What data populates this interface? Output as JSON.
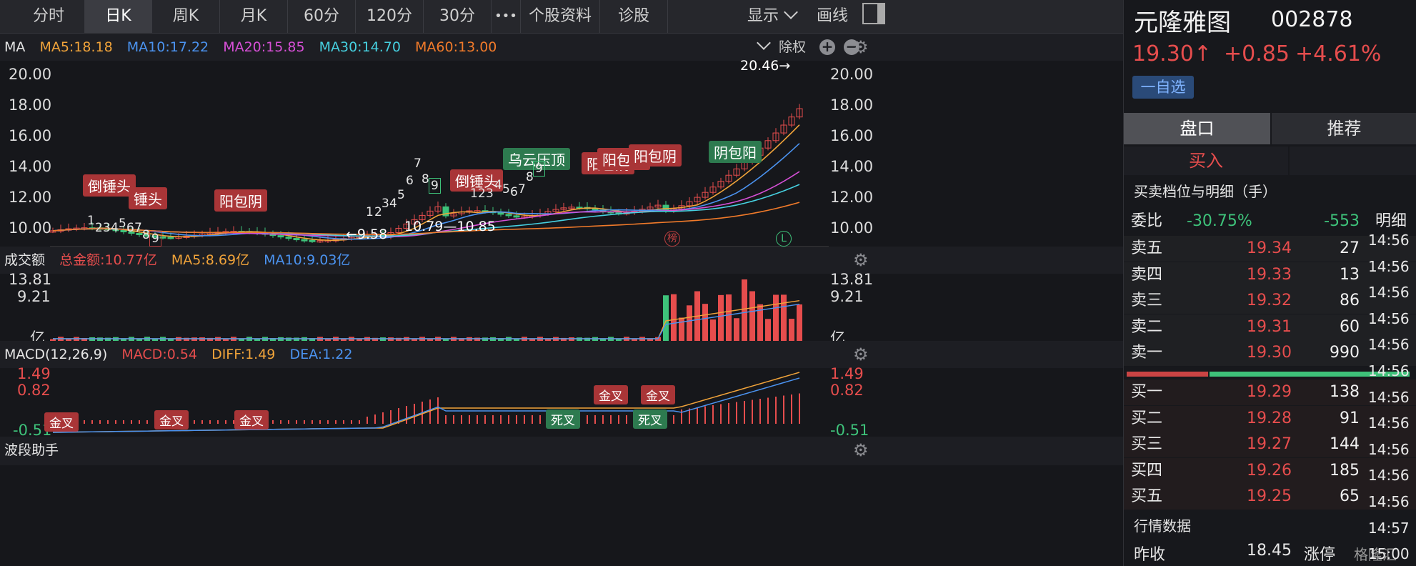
{
  "tabs": [
    "分时",
    "日K",
    "周K",
    "月K",
    "60分",
    "120分",
    "30分",
    "•••",
    "个股资料",
    "诊股"
  ],
  "active_tab": "日K",
  "toolbar": {
    "display": "显示",
    "draw": "画线"
  },
  "ma_header": {
    "label": "MA",
    "ma5": "MA5:18.18",
    "ma10": "MA10:17.22",
    "ma20": "MA20:15.85",
    "ma30": "MA30:14.70",
    "ma60": "MA60:13.00",
    "adjust": "除权"
  },
  "price_axis": [
    "20.00",
    "18.00",
    "16.00",
    "14.00",
    "12.00",
    "10.00"
  ],
  "price_annotations": {
    "high": "20.46→",
    "low": "←9.58",
    "range": "10.79—10.85",
    "rank_icon": "榜",
    "l_icon": "L"
  },
  "patterns": [
    {
      "text": "倒锤头",
      "kind": "r"
    },
    {
      "text": "锤头",
      "kind": "r"
    },
    {
      "text": "阳包阴",
      "kind": "r"
    },
    {
      "text": "倒锤头",
      "kind": "r"
    },
    {
      "text": "乌云压顶",
      "kind": "g"
    },
    {
      "text": "阳包阴",
      "kind": "r"
    },
    {
      "text": "阳包阴",
      "kind": "r"
    },
    {
      "text": "阳包阴",
      "kind": "r"
    },
    {
      "text": "阴包阳",
      "kind": "g"
    }
  ],
  "volume_header": {
    "label": "成交额",
    "total": "总金额:10.77亿",
    "ma5": "MA5:8.69亿",
    "ma10": "MA10:9.03亿"
  },
  "volume_axis": [
    "13.81",
    "9.21",
    "亿"
  ],
  "macd_header": {
    "label": "MACD(12,26,9)",
    "macd": "MACD:0.54",
    "diff": "DIFF:1.49",
    "dea": "DEA:1.22"
  },
  "macd_axis": [
    "1.49",
    "0.82",
    "-0.51"
  ],
  "macd_signals": [
    {
      "text": "金叉",
      "kind": "r"
    },
    {
      "text": "金叉",
      "kind": "r"
    },
    {
      "text": "金叉",
      "kind": "r"
    },
    {
      "text": "金叉",
      "kind": "r"
    },
    {
      "text": "金叉",
      "kind": "r"
    },
    {
      "text": "死叉",
      "kind": "g"
    },
    {
      "text": "死叉",
      "kind": "g"
    }
  ],
  "bottom_panel": {
    "label": "波段助手"
  },
  "stock": {
    "name": "元隆雅图",
    "code": "002878",
    "price": "19.30↑",
    "change": "+0.85",
    "pct": "+4.61%",
    "watch": "一自选"
  },
  "panel_tabs": {
    "left": "盘口",
    "right": "推荐"
  },
  "buy_tab": "买入",
  "book_title": "买卖档位与明细（手）",
  "ratio": {
    "label": "委比",
    "pct": "-30.75%",
    "diff": "-553",
    "detail": "明细"
  },
  "asks": [
    {
      "label": "卖五",
      "price": "19.34",
      "vol": "27"
    },
    {
      "label": "卖四",
      "price": "19.33",
      "vol": "13"
    },
    {
      "label": "卖三",
      "price": "19.32",
      "vol": "86"
    },
    {
      "label": "卖二",
      "price": "19.31",
      "vol": "60"
    },
    {
      "label": "卖一",
      "price": "19.30",
      "vol": "990"
    }
  ],
  "bids": [
    {
      "label": "买一",
      "price": "19.29",
      "vol": "138"
    },
    {
      "label": "买二",
      "price": "19.28",
      "vol": "91"
    },
    {
      "label": "买三",
      "price": "19.27",
      "vol": "144"
    },
    {
      "label": "买四",
      "price": "19.26",
      "vol": "185"
    },
    {
      "label": "买五",
      "price": "19.25",
      "vol": "65"
    }
  ],
  "detail_times": [
    "14:56",
    "14:56",
    "14:56",
    "14:56",
    "14:56",
    "14:56",
    "14:56",
    "14:56",
    "14:56",
    "14:56",
    "14:56",
    "14:57",
    "15:00"
  ],
  "market": {
    "title": "行情数据",
    "prev_close_label": "昨收",
    "prev_close": "18.45",
    "limit_label": "涨停",
    "watermark": "格隆汇"
  },
  "colors": {
    "up": "#e64d4d",
    "down": "#3ec27a",
    "ma5": "#f0a33a",
    "ma10": "#4b93f0",
    "ma20": "#d64fd6",
    "ma30": "#46d0e0",
    "ma60": "#f07a2a"
  }
}
